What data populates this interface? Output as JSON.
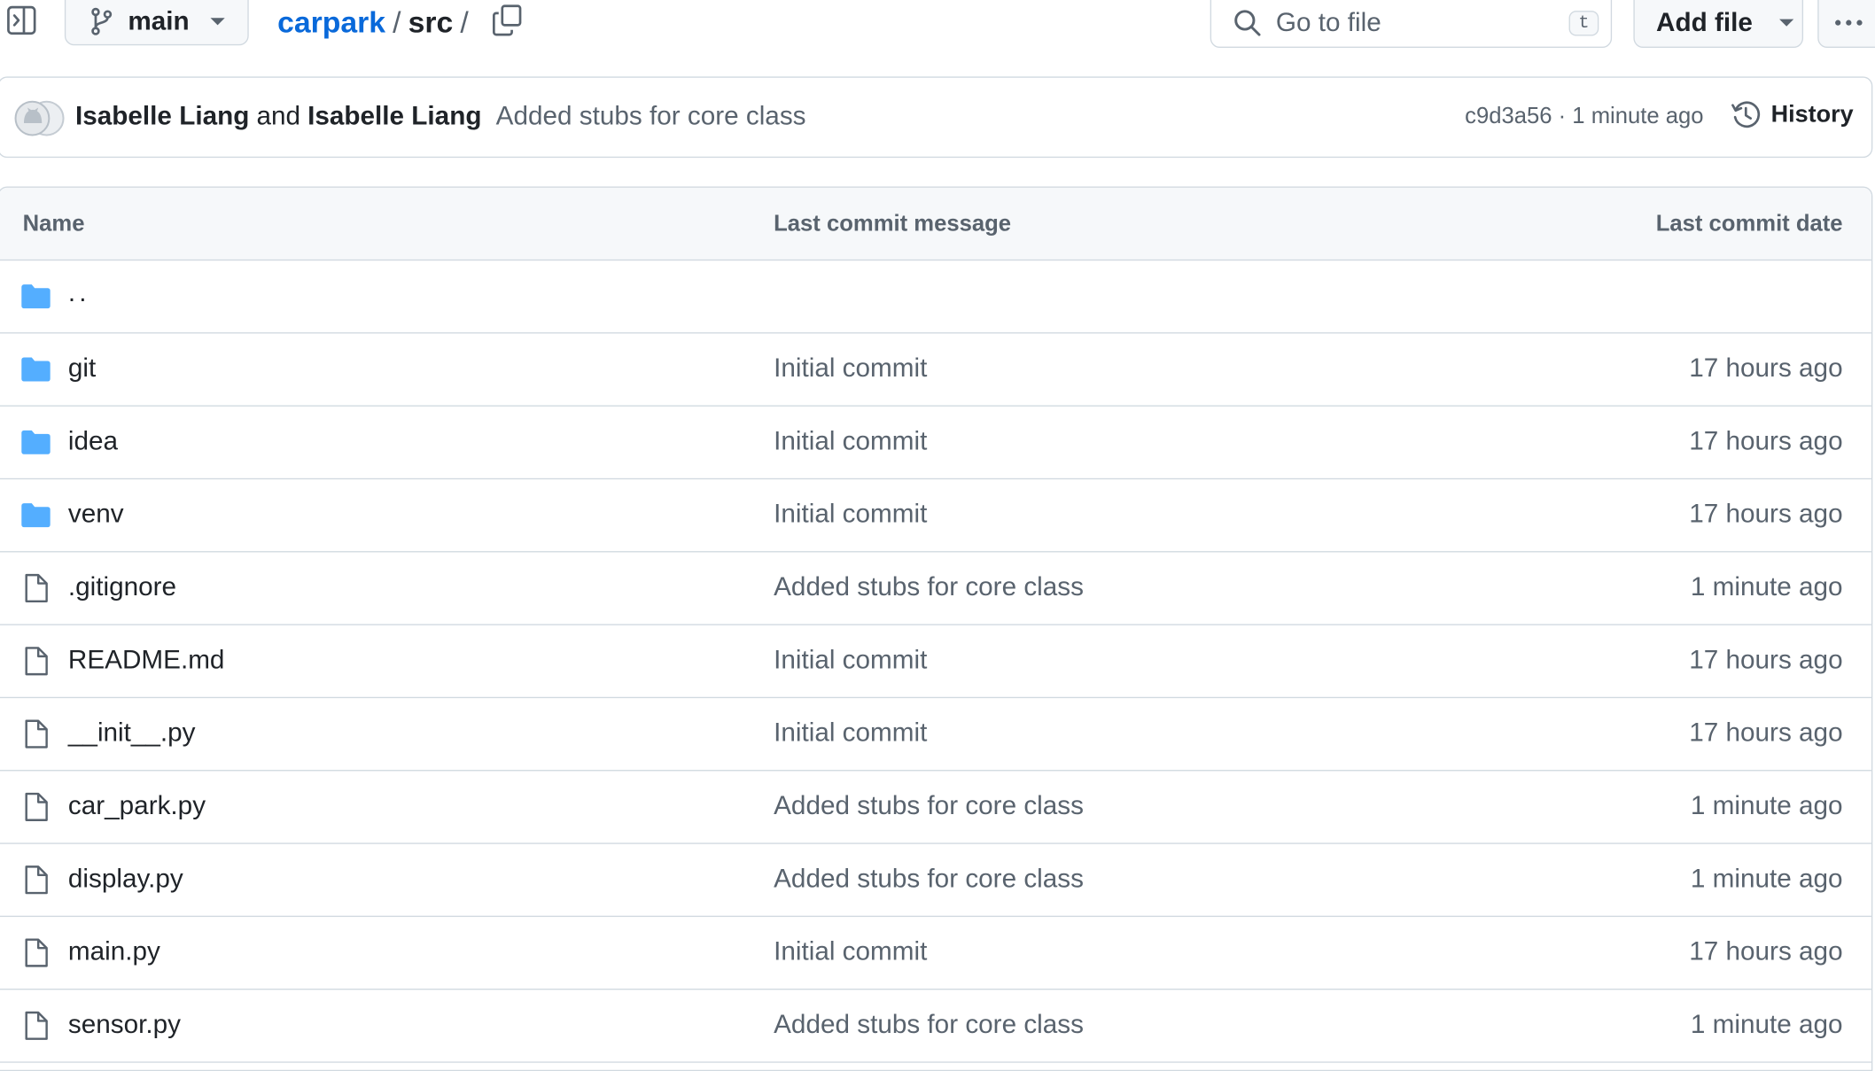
{
  "toolbar": {
    "branch_label": "main",
    "breadcrumb": {
      "repo": "carpark",
      "sep1": "/",
      "folder": "src",
      "sep2": "/"
    },
    "search_placeholder": "Go to file",
    "search_shortcut": "t",
    "add_file_label": "Add file"
  },
  "latest_commit": {
    "author1": "Isabelle Liang",
    "and_word": "and",
    "author2": "Isabelle Liang",
    "message": "Added stubs for core class",
    "meta": "c9d3a56 · 1 minute ago",
    "history_label": "History"
  },
  "table": {
    "headers": {
      "name": "Name",
      "message": "Last commit message",
      "date": "Last commit date"
    },
    "parent_label": "..",
    "rows": [
      {
        "type": "folder",
        "name": "git",
        "message": "Initial commit",
        "date": "17 hours ago"
      },
      {
        "type": "folder",
        "name": "idea",
        "message": "Initial commit",
        "date": "17 hours ago"
      },
      {
        "type": "folder",
        "name": "venv",
        "message": "Initial commit",
        "date": "17 hours ago"
      },
      {
        "type": "file",
        "name": ".gitignore",
        "message": "Added stubs for core class",
        "date": "1 minute ago"
      },
      {
        "type": "file",
        "name": "README.md",
        "message": "Initial commit",
        "date": "17 hours ago"
      },
      {
        "type": "file",
        "name": "__init__.py",
        "message": "Initial commit",
        "date": "17 hours ago"
      },
      {
        "type": "file",
        "name": "car_park.py",
        "message": "Added stubs for core class",
        "date": "1 minute ago"
      },
      {
        "type": "file",
        "name": "display.py",
        "message": "Added stubs for core class",
        "date": "1 minute ago"
      },
      {
        "type": "file",
        "name": "main.py",
        "message": "Initial commit",
        "date": "17 hours ago"
      },
      {
        "type": "file",
        "name": "sensor.py",
        "message": "Added stubs for core class",
        "date": "1 minute ago"
      }
    ]
  },
  "colors": {
    "link": "#0969da",
    "folder": "#54aeff",
    "muted": "#59636e",
    "border": "#d1d9e0",
    "header_bg": "#f6f8fa"
  },
  "icons": {
    "sidebar": "sidebar-expand-icon",
    "branch": "git-branch-icon",
    "copy": "copy-icon",
    "search": "search-icon",
    "more": "kebab-horizontal-icon",
    "history": "history-icon",
    "folder": "folder-icon",
    "file": "file-icon"
  }
}
